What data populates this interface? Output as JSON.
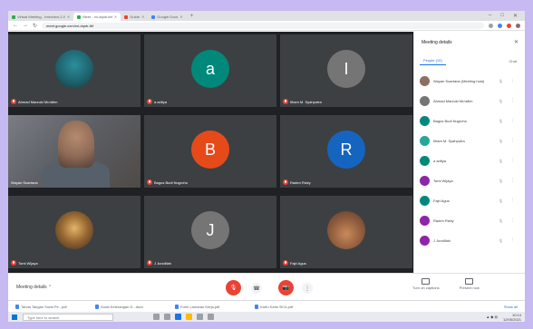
{
  "browser": {
    "tabs": [
      {
        "label": "Virtual Meeting - Interview 2.0",
        "active": false,
        "color": "#34a853"
      },
      {
        "label": "Meet - rxi-dqnb-tbf",
        "active": true,
        "color": "#34a853"
      },
      {
        "label": "Guide",
        "active": false,
        "color": "#ea4335"
      },
      {
        "label": "Google Docs",
        "active": false,
        "color": "#4285f4"
      }
    ],
    "new_tab_label": "+",
    "url": "meet.google.com/rxi-dqnb-tbf",
    "window_controls": [
      "–",
      "□",
      "✕"
    ]
  },
  "stage": {
    "tiles": [
      {
        "name": "Ahmad Marzuki Mu'allim",
        "avatar_type": "image",
        "avatar_style": "whale",
        "avatar_letter": ""
      },
      {
        "name": "a aditya",
        "avatar_type": "letter",
        "avatar_letter": "a",
        "avatar_color": "#00897b"
      },
      {
        "name": "Ilham M. Syahputra",
        "avatar_type": "letter",
        "avatar_letter": "I",
        "avatar_color": "#757575"
      },
      {
        "name": "Wayan Suartana",
        "avatar_type": "video",
        "avatar_letter": ""
      },
      {
        "name": "Bagus Budi Nugroho",
        "avatar_type": "letter",
        "avatar_letter": "B",
        "avatar_color": "#e64a19"
      },
      {
        "name": "Raden Rizky",
        "avatar_type": "letter",
        "avatar_letter": "R",
        "avatar_color": "#1565c0"
      },
      {
        "name": "Tomi Wijaya",
        "avatar_type": "image",
        "avatar_style": "photo1",
        "avatar_letter": ""
      },
      {
        "name": "J Jundillah",
        "avatar_type": "letter",
        "avatar_letter": "J",
        "avatar_color": "#757575"
      },
      {
        "name": "Fajri Agus",
        "avatar_type": "image",
        "avatar_style": "photo2",
        "avatar_letter": ""
      }
    ]
  },
  "bottom": {
    "meeting_label": "Meeting details",
    "controls": {
      "mic": "🎙",
      "cam": "📷",
      "end": "☎",
      "more": "⋮"
    },
    "actions": [
      {
        "label": "Turn on captions"
      },
      {
        "label": "Present now"
      }
    ]
  },
  "downloads": {
    "items": [
      "Tanda Tangan Surat Pe...pdf",
      "Surat Keterangan D...docx",
      "Form Lamaran Kerja.pdf",
      "Kartu Kartu BCA.pdf"
    ],
    "show_all": "Show all"
  },
  "taskbar": {
    "search_placeholder": "Type here to search",
    "time": "10:14",
    "date": "12/05/2021"
  },
  "panel": {
    "title": "Meeting details",
    "close": "✕",
    "tabs": [
      {
        "label": "People (10)",
        "active": true
      },
      {
        "label": "Chat",
        "active": false
      }
    ],
    "participants": [
      {
        "name": "Wayan Suartana (Meeting host)",
        "color": "#8d6e63"
      },
      {
        "name": "Ahmad Marzuki Mu'allim",
        "color": "#757575"
      },
      {
        "name": "Bagus Budi Nugroho",
        "color": "#00897b"
      },
      {
        "name": "Ilham M. Syahputra",
        "color": "#26a69a"
      },
      {
        "name": "a aditya",
        "color": "#00897b"
      },
      {
        "name": "Tomi Wijaya",
        "color": "#8e24aa"
      },
      {
        "name": "Fajri Agus",
        "color": "#00897b"
      },
      {
        "name": "Raden Rizky",
        "color": "#8e24aa"
      },
      {
        "name": "J Jundillah",
        "color": "#8e24aa"
      }
    ]
  }
}
